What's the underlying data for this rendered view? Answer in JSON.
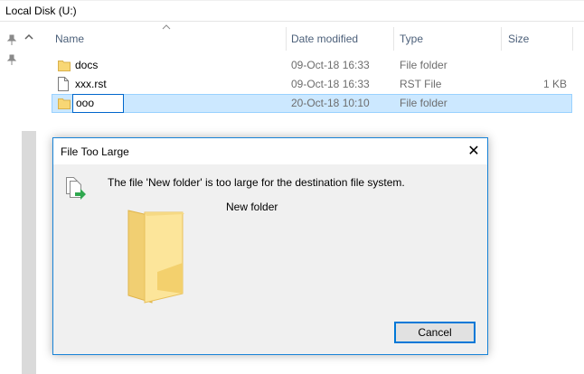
{
  "window": {
    "title": "Local Disk (U:)"
  },
  "columns": {
    "name": "Name",
    "date_modified": "Date modified",
    "type": "Type",
    "size": "Size"
  },
  "files": [
    {
      "name": "docs",
      "date": "09-Oct-18 16:33",
      "type": "File folder",
      "size": "",
      "icon": "folder-icon"
    },
    {
      "name": "xxx.rst",
      "date": "09-Oct-18 16:33",
      "type": "RST File",
      "size": "1 KB",
      "icon": "file-icon"
    },
    {
      "name": "ooo",
      "date": "20-Oct-18 10:10",
      "type": "File folder",
      "size": "",
      "icon": "folder-icon",
      "renaming": true
    }
  ],
  "dialog": {
    "title": "File Too Large",
    "close_glyph": "✕",
    "message": "The file 'New folder' is too large for the destination file system.",
    "file_name": "New folder",
    "cancel_label": "Cancel"
  },
  "colors": {
    "selection": "#cce8ff",
    "selection_border": "#99d1ff",
    "accent": "#0078d7",
    "folder": "#f8d775"
  }
}
